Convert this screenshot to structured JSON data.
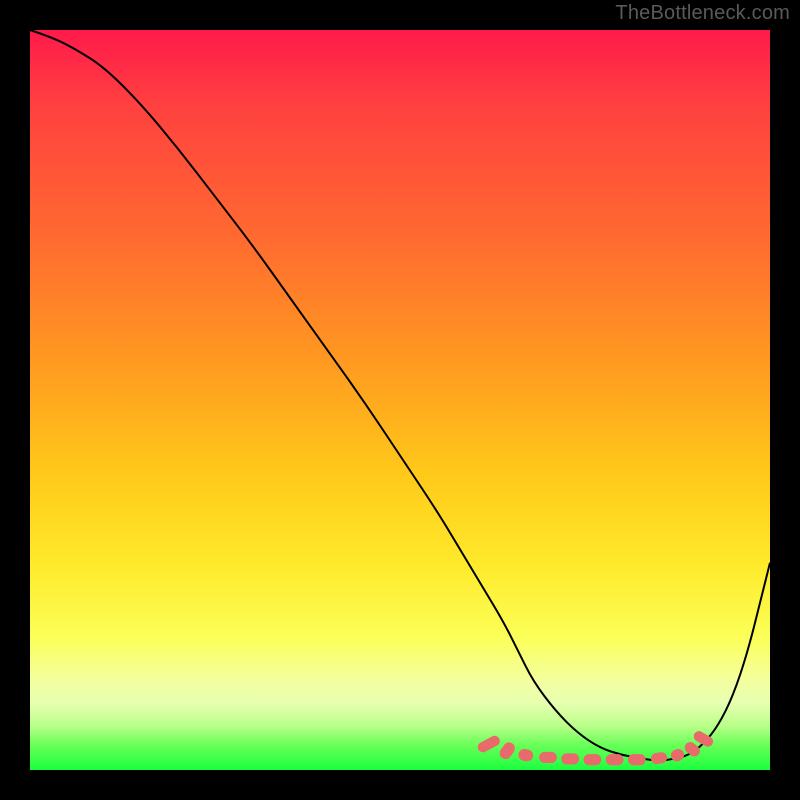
{
  "watermark": "TheBottleneck.com",
  "chart_data": {
    "type": "line",
    "title": "",
    "xlabel": "",
    "ylabel": "",
    "xlim": [
      0,
      100
    ],
    "ylim": [
      0,
      100
    ],
    "grid": false,
    "legend": false,
    "series": [
      {
        "name": "bottleneck-curve",
        "color": "#000000",
        "x": [
          0,
          3,
          6,
          10,
          15,
          20,
          25,
          30,
          35,
          40,
          45,
          50,
          55,
          58,
          61,
          64,
          66,
          68,
          71,
          74,
          77,
          80,
          83,
          85,
          87,
          89,
          91,
          93,
          95,
          97,
          99,
          100
        ],
        "y": [
          100,
          99,
          97.5,
          95,
          90,
          84,
          77.5,
          71,
          64,
          57,
          50,
          42.5,
          35,
          30,
          25,
          20,
          16,
          12,
          8,
          5,
          3,
          2,
          1.5,
          1.2,
          1.5,
          2,
          3.5,
          6,
          10,
          16,
          24,
          28
        ]
      }
    ],
    "markers": [
      {
        "name": "trough-markers",
        "color": "#e86a6a",
        "shape": "rounded-rect",
        "points": [
          {
            "x": 62,
            "y": 3.5,
            "w": 1.4,
            "h": 3.2,
            "rot": 62
          },
          {
            "x": 64.5,
            "y": 2.6,
            "w": 1.6,
            "h": 2.4,
            "rot": 35
          },
          {
            "x": 67,
            "y": 2.0,
            "w": 2.0,
            "h": 1.6,
            "rot": 10
          },
          {
            "x": 70,
            "y": 1.7,
            "w": 2.4,
            "h": 1.5,
            "rot": 0
          },
          {
            "x": 73,
            "y": 1.5,
            "w": 2.4,
            "h": 1.5,
            "rot": 0
          },
          {
            "x": 76,
            "y": 1.4,
            "w": 2.4,
            "h": 1.5,
            "rot": 0
          },
          {
            "x": 79,
            "y": 1.4,
            "w": 2.4,
            "h": 1.5,
            "rot": 0
          },
          {
            "x": 82,
            "y": 1.4,
            "w": 2.4,
            "h": 1.5,
            "rot": 0
          },
          {
            "x": 85,
            "y": 1.6,
            "w": 2.2,
            "h": 1.5,
            "rot": -8
          },
          {
            "x": 87.5,
            "y": 2.0,
            "w": 1.8,
            "h": 1.6,
            "rot": -25
          },
          {
            "x": 89.5,
            "y": 2.8,
            "w": 1.5,
            "h": 2.2,
            "rot": -50
          },
          {
            "x": 91,
            "y": 4.2,
            "w": 1.4,
            "h": 2.8,
            "rot": -60
          }
        ]
      }
    ],
    "gradient_stops": [
      {
        "pos": 0,
        "color": "#ff1a4b"
      },
      {
        "pos": 45,
        "color": "#ff9a20"
      },
      {
        "pos": 72,
        "color": "#ffe92a"
      },
      {
        "pos": 92,
        "color": "#d8ffad"
      },
      {
        "pos": 100,
        "color": "#1aff3e"
      }
    ]
  }
}
